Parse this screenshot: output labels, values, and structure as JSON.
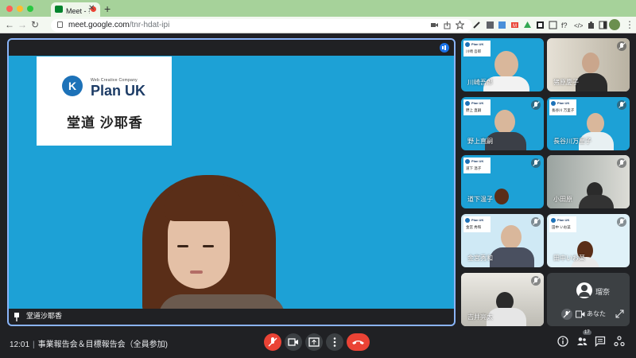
{
  "browser": {
    "tab_title": "Meet - 事業報告会＆目標報告会",
    "url_host": "meet.google.com",
    "url_path": "/tnr-hdat-ipi",
    "traffic_colors": [
      "#ff5f57",
      "#febc2e",
      "#28c840"
    ]
  },
  "main_tile": {
    "speaker_name": "堂道沙耶香",
    "card": {
      "tagline": "Web Creative Company",
      "brand": "Plan UK",
      "logo_letter": "K",
      "name": "堂道 沙耶香"
    }
  },
  "participants": [
    {
      "name": "川崎吾郎",
      "card_name": "川崎 吾郎",
      "bg": "blue",
      "muted": false
    },
    {
      "name": "猪原慶子",
      "card_name": "",
      "bg": "room",
      "muted": true
    },
    {
      "name": "野上直嗣",
      "card_name": "野上 直嗣",
      "bg": "blue",
      "muted": true
    },
    {
      "name": "長谷川万里子",
      "card_name": "長谷川 万里子",
      "bg": "blue",
      "muted": true
    },
    {
      "name": "道下温子",
      "card_name": "道下 温子",
      "bg": "blue",
      "muted": true
    },
    {
      "name": "小田原",
      "card_name": "",
      "bg": "room",
      "muted": true
    },
    {
      "name": "金宮秀和",
      "card_name": "金宮 秀和",
      "bg": "blue",
      "muted": true
    },
    {
      "name": "田中いお菜",
      "card_name": "田中 いお菜",
      "bg": "blue",
      "muted": true
    },
    {
      "name": "吉井亮太",
      "card_name": "",
      "bg": "room",
      "muted": true
    }
  ],
  "self_tile": {
    "name": "瑠奈",
    "label": "あなた"
  },
  "controls": {
    "time": "12:01",
    "meeting_title": "事業報告会＆目標報告会（全員参加)",
    "people_count": "17"
  }
}
